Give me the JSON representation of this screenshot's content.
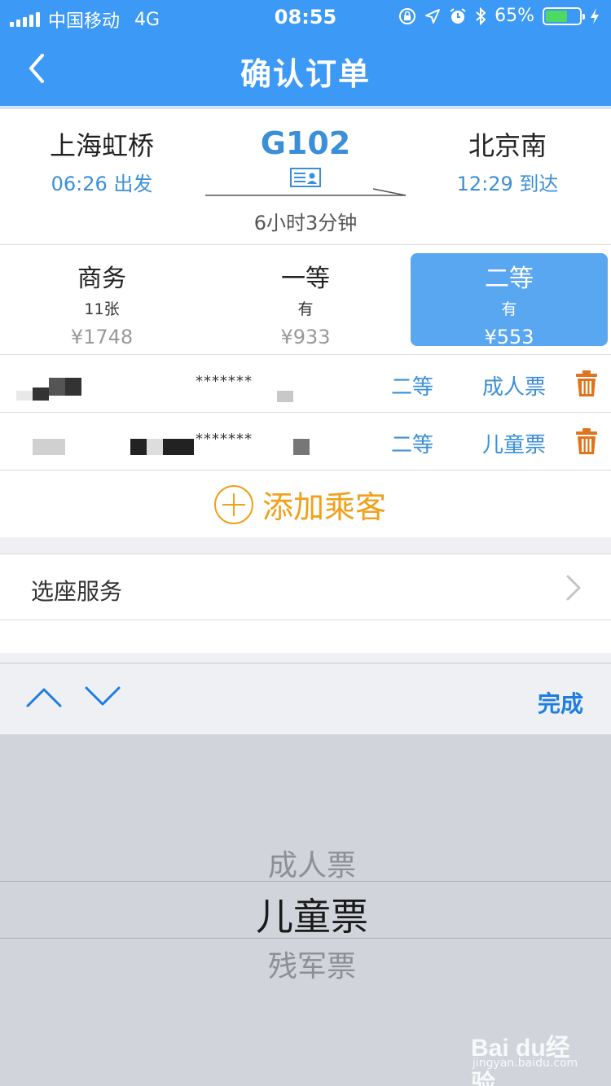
{
  "status_bar": {
    "carrier": "中国移动",
    "network": "4G",
    "time": "08:55",
    "battery": "65%",
    "battery_level": 0.65
  },
  "nav": {
    "title": "确认订单"
  },
  "trip": {
    "from_station": "上海虹桥",
    "depart_time": "06:26 出发",
    "train_no": "G102",
    "duration": "6小时3分钟",
    "to_station": "北京南",
    "arrive_time": "12:29 到达"
  },
  "seat_classes": [
    {
      "name": "商务",
      "availability": "11张",
      "price": "¥1748"
    },
    {
      "name": "一等",
      "availability": "有",
      "price": "¥933"
    },
    {
      "name": "二等",
      "availability": "有",
      "price": "¥553",
      "selected": true
    }
  ],
  "passengers": [
    {
      "id_masked": "*******",
      "seat_class": "二等",
      "ticket_type": "成人票"
    },
    {
      "id_masked": "*******",
      "seat_class": "二等",
      "ticket_type": "儿童票"
    }
  ],
  "add_passenger": "添加乘客",
  "seat_service": "选座服务",
  "accessory": {
    "done": "完成"
  },
  "picker": {
    "options": [
      "成人票",
      "儿童票",
      "残军票"
    ],
    "selected": "儿童票"
  },
  "watermark": {
    "brand": "Bai du经验",
    "url": "jingyan.baidu.com"
  },
  "colors": {
    "primary": "#3c99f5",
    "link": "#3b8fd8",
    "accent_orange": "#f0a019",
    "selected_seat": "#5aa7f1"
  }
}
